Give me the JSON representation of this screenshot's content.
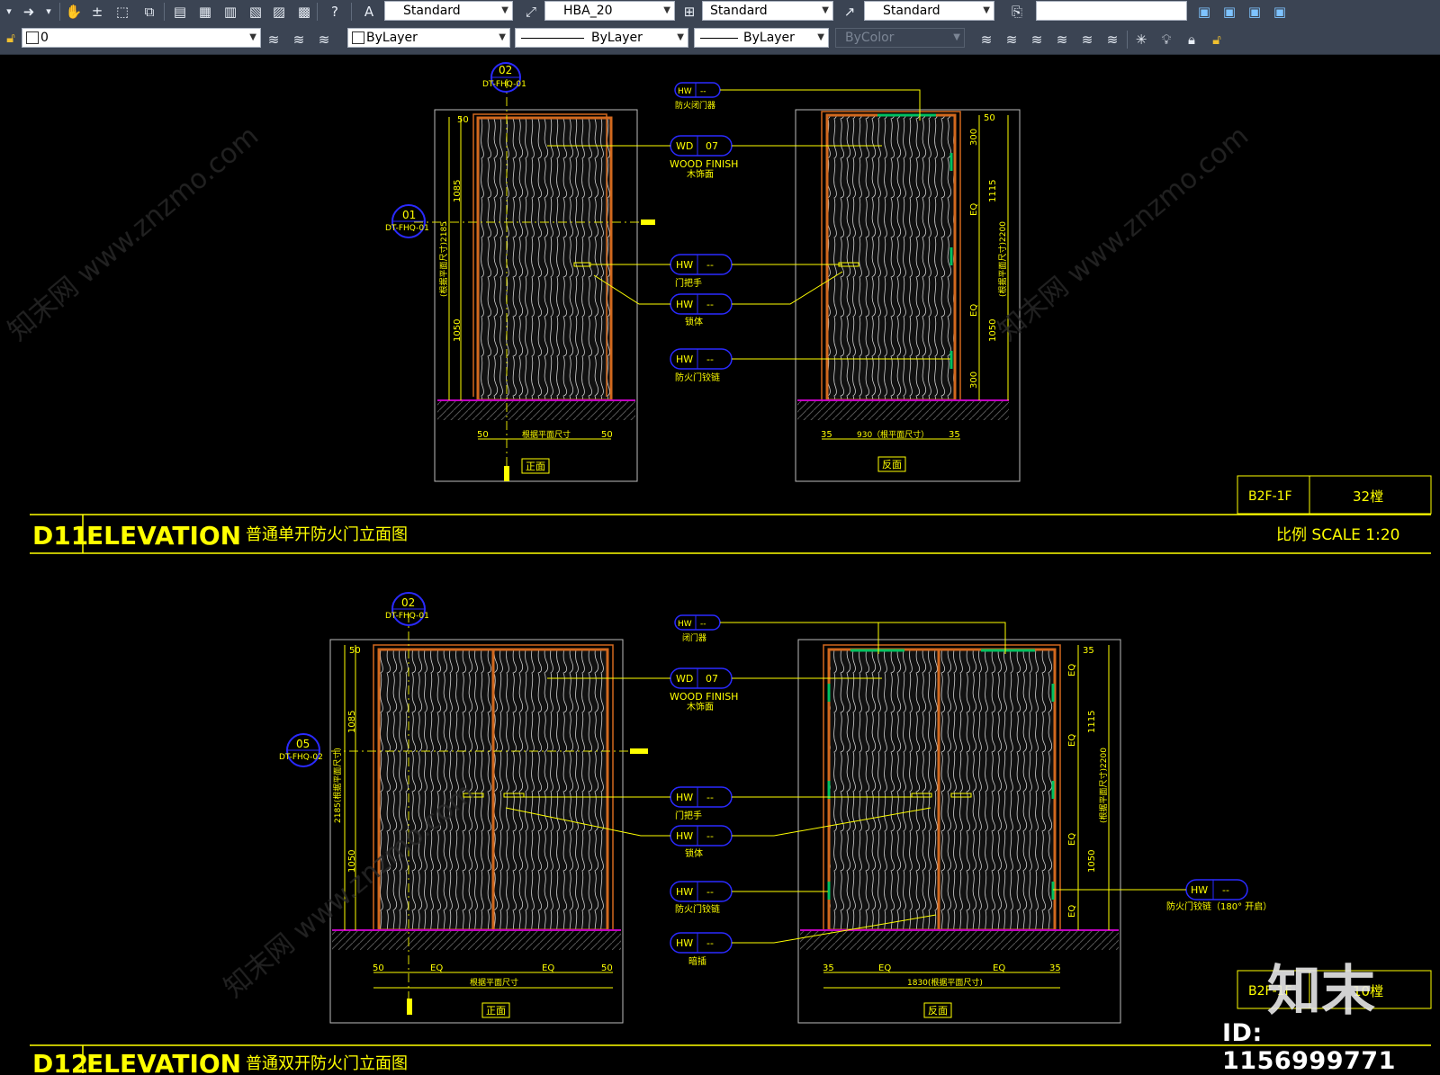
{
  "toolbar1": {
    "text_style": "Standard",
    "dim_style": "HBA_20",
    "table_style": "Standard",
    "mleader_style": "Standard",
    "search_value": ""
  },
  "toolbar2": {
    "layer_name": "0",
    "color": "ByLayer",
    "linetype": "ByLayer",
    "lineweight": "ByLayer",
    "plot_style": "ByColor"
  },
  "colors": {
    "toolbar_bg": "#3b4453",
    "canvas_bg": "#000000",
    "annotation_yellow": "#ffff00",
    "door_frame_orange": "#d2691e",
    "callout_blue": "#2a2aff",
    "floor_magenta": "#c000c0",
    "hinge_green": "#00c060"
  },
  "drawing": {
    "d11": {
      "code": "D11",
      "title": "ELEVATION",
      "title_cn": "普通单开防火门立面图",
      "scale_label": "比例 SCALE 1:20",
      "info_box": {
        "floor": "B2F-1F",
        "building": "32樘"
      },
      "front_label": "正面",
      "back_label": "反面",
      "section_callout": {
        "num": "02",
        "ref": "DT-FHQ-01"
      },
      "detail_callout": {
        "num": "01",
        "ref": "DT-FHQ-01"
      },
      "tags": [
        {
          "type": "HW",
          "code": "--",
          "label": "防火闭门器"
        },
        {
          "type": "WD",
          "code": "07",
          "label": "WOOD FINISH",
          "label2": "木饰面"
        },
        {
          "type": "HW",
          "code": "--",
          "label": "门把手"
        },
        {
          "type": "HW",
          "code": "--",
          "label": "锁体"
        },
        {
          "type": "HW",
          "code": "--",
          "label": "防火门铰链"
        }
      ],
      "dims_left": {
        "top": "50",
        "upper": "1085",
        "lower": "1050",
        "total": "(根据平面尺寸)2185"
      },
      "dims_right": {
        "top": "50",
        "a": "300",
        "b": "EQ",
        "c": "EQ",
        "d": "300",
        "upper": "1115",
        "lower": "1050",
        "total": "(根据平面尺寸)2200"
      },
      "dims_bottom_front": {
        "left": "50",
        "mid": "根据平面尺寸",
        "right": "50"
      },
      "dims_bottom_back": {
        "left": "35",
        "mid": "930（根平面尺寸）",
        "right": "35"
      }
    },
    "d12": {
      "code": "D12",
      "title": "ELEVATION",
      "title_cn": "普通双开防火门立面图",
      "info_box": {
        "floor": "B2F-1F",
        "building": "10樘"
      },
      "front_label": "正面",
      "back_label": "反面",
      "section_callout": {
        "num": "02",
        "ref": "DT-FHQ-01"
      },
      "detail_callout": {
        "num": "05",
        "ref": "DT-FHQ-02"
      },
      "tags": [
        {
          "type": "HW",
          "code": "--",
          "label": "闭门器"
        },
        {
          "type": "WD",
          "code": "07",
          "label": "WOOD FINISH",
          "label2": "木饰面"
        },
        {
          "type": "HW",
          "code": "--",
          "label": "门把手"
        },
        {
          "type": "HW",
          "code": "--",
          "label": "锁体"
        },
        {
          "type": "HW",
          "code": "--",
          "label": "防火门铰链"
        },
        {
          "type": "HW",
          "code": "--",
          "label": "暗插"
        }
      ],
      "side_tag": {
        "type": "HW",
        "code": "--",
        "label": "防火门铰链（180° 开启）"
      },
      "dims_left": {
        "top": "50",
        "upper": "1085",
        "lower": "1050",
        "total": "2185(根据平面尺寸)"
      },
      "dims_right": {
        "top": "35",
        "a": "EQ",
        "b": "EQ",
        "c": "EQ",
        "d": "EQ",
        "upper": "1115",
        "lower": "1050",
        "total": "(根据平面尺寸)2200"
      },
      "dims_bottom_front": {
        "l": "50",
        "eq1": "EQ",
        "eq2": "EQ",
        "r": "50",
        "mid": "根据平面尺寸"
      },
      "dims_bottom_back": {
        "l": "35",
        "eq1": "EQ",
        "eq2": "EQ",
        "r": "35",
        "mid": "1830(根据平面尺寸)"
      }
    }
  },
  "watermark": {
    "text": "知末网 www.znzmo.com",
    "logo": "知末",
    "id": "ID: 1156999771"
  }
}
